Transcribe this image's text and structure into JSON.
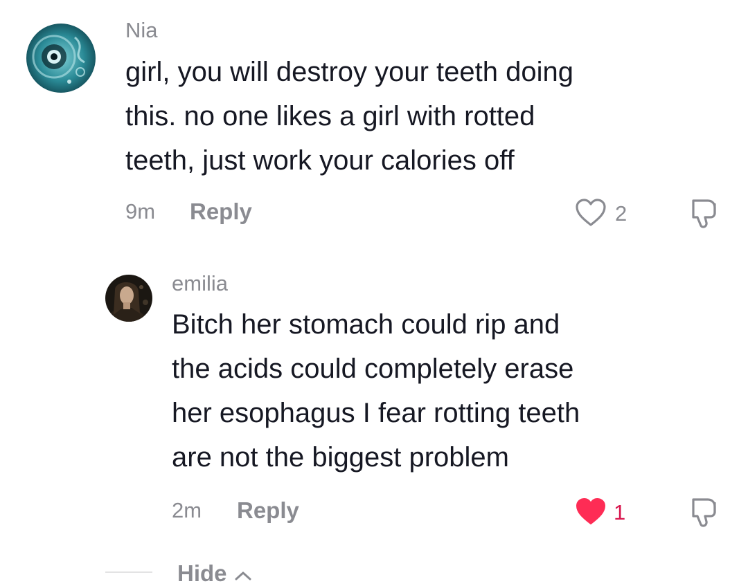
{
  "comments": [
    {
      "username": "Nia",
      "text": "girl, you will destroy your teeth doing\nthis. no one likes a girl with rotted\nteeth, just work your calories off",
      "time": "9m",
      "reply_label": "Reply",
      "like_count": "2",
      "liked": false,
      "avatar_icon": "avatar-image"
    },
    {
      "username": "emilia",
      "text": "Bitch her stomach could rip and\nthe acids could completely erase\nher esophagus I fear rotting teeth\nare not the biggest problem",
      "time": "2m",
      "reply_label": "Reply",
      "like_count": "1",
      "liked": true,
      "avatar_icon": "avatar-image"
    }
  ],
  "replies_toggle": {
    "label": "Hide",
    "icon": "chevron-up-icon"
  },
  "colors": {
    "text": "#161823",
    "muted": "#8a8b91",
    "like_active": "#fe2c55"
  }
}
